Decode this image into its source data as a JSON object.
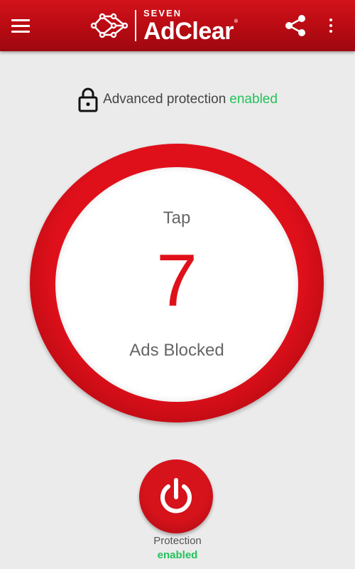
{
  "app": {
    "brand_top": "SEVEN",
    "brand_main": "AdClear",
    "brand_reg": "®"
  },
  "toolbar": {
    "menu_icon": "hamburger-menu-icon",
    "share_icon": "share-icon",
    "more_icon": "more-vert-icon"
  },
  "advanced_protection": {
    "label": "Advanced protection",
    "status": "enabled",
    "icon": "lock-icon"
  },
  "counter": {
    "tap_label": "Tap",
    "count": "7",
    "count_label": "Ads Blocked"
  },
  "protection": {
    "label": "Protection",
    "status": "enabled",
    "icon": "power-icon"
  },
  "colors": {
    "brand_red": "#d3121a",
    "accent_green": "#24c25b",
    "background": "#ebebeb"
  }
}
